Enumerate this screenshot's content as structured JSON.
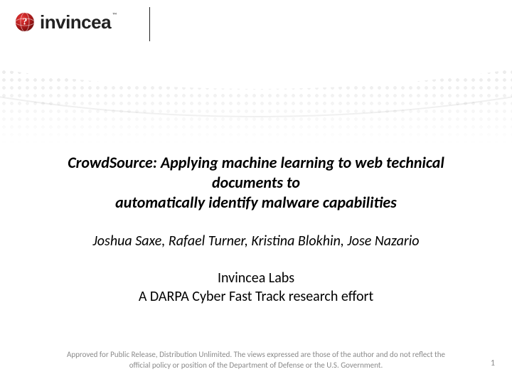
{
  "brand": {
    "name": "invincea",
    "tm": "™",
    "logo_color": "#b31b1b"
  },
  "title": {
    "line1": "CrowdSource:  Applying machine learning to web technical documents to",
    "line2": "automatically identify malware capabilities"
  },
  "authors": "Joshua Saxe, Rafael Turner, Kristina Blokhin, Jose Nazario",
  "org": "Invincea Labs",
  "subtitle": "A DARPA Cyber Fast Track research effort",
  "footer": {
    "line1": "Approved for Public Release, Distribution Unlimited.  The views expressed are those of the author and do not reflect the",
    "line2": "official policy or position of the Department of Defense or the U.S. Government."
  },
  "page_number": "1"
}
